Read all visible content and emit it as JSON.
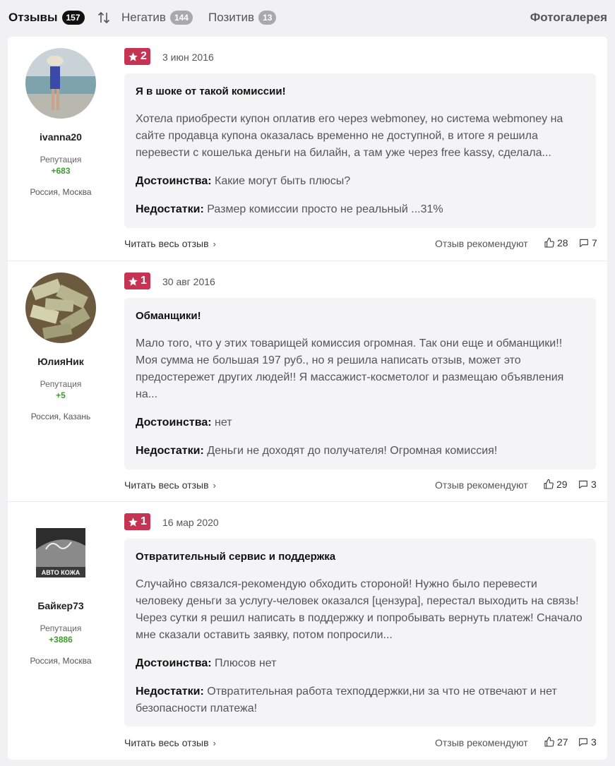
{
  "tabs": {
    "reviews": {
      "label": "Отзывы",
      "count": "157"
    },
    "negative": {
      "label": "Негатив",
      "count": "144"
    },
    "positive": {
      "label": "Позитив",
      "count": "13"
    },
    "gallery": "Фотогалерея"
  },
  "labels": {
    "reputation": "Репутация",
    "pros": "Достоинства:",
    "cons": "Недостатки:",
    "read_more": "Читать весь отзыв",
    "recommend": "Отзыв рекомендуют"
  },
  "reviews": [
    {
      "username": "ivanna20",
      "reputation": "+683",
      "location": "Россия, Москва",
      "rating": "2",
      "date": "3 июн 2016",
      "title": "Я в шоке от такой комиссии!",
      "text": "Хотела приобрести купон оплатив его через webmoney, но система webmoney на сайте продавца купона оказалась временно не доступной, в итоге я решила перевести с кошелька деньги на билайн, а там уже через free kassy, сделала...",
      "pros": "Какие могут быть плюсы?",
      "cons": "Размер комиссии просто не реальный ...31%",
      "likes": "28",
      "comments": "7"
    },
    {
      "username": "ЮлияНик",
      "reputation": "+5",
      "location": "Россия, Казань",
      "rating": "1",
      "date": "30 авг 2016",
      "title": "Обманщики!",
      "text": "Мало того, что у этих товарищей комиссия огромная. Так они еще и обманщики!! Моя сумма не большая 197 руб., но я решила написать отзыв, может это предостережет других людей!! Я массажист-косметолог и размещаю объявления на...",
      "pros": "нет",
      "cons": "Деньги не доходят до получателя! Огромная комиссия!",
      "likes": "29",
      "comments": "3"
    },
    {
      "username": "Байкер73",
      "reputation": "+3886",
      "location": "Россия, Москва",
      "rating": "1",
      "date": "16 мар 2020",
      "title": "Отвратительный сервис и поддержка",
      "text": "Случайно связался-рекомендую обходить стороной! Нужно было перевести человеку деньги за услугу-человек оказался [цензура], перестал выходить на связь! Через сутки я решил написать в поддержку и попробывать вернуть платеж! Сначало мне сказали оставить заявку, потом попросили...",
      "pros": "Плюсов нет",
      "cons": "Отвратительная работа техподдержки,ни за что не отвечают и нет безопасности платежа!",
      "likes": "27",
      "comments": "3",
      "avatar_text": "АВТО КОЖА"
    }
  ]
}
